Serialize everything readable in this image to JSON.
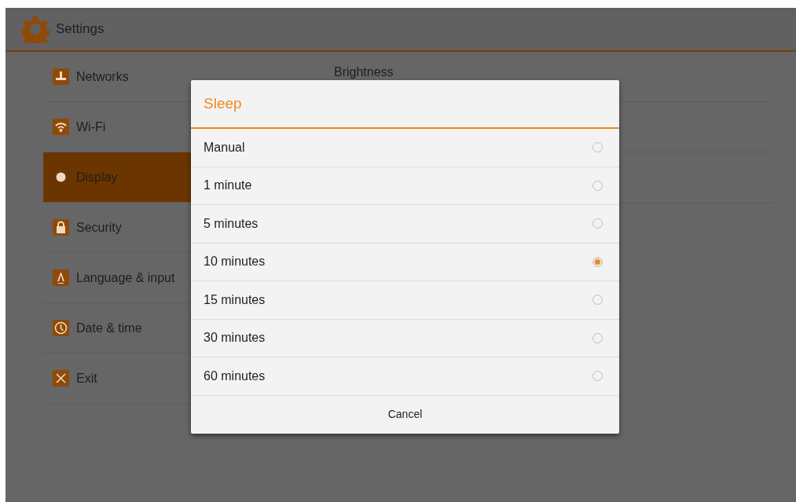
{
  "app_bar": {
    "title": "Settings"
  },
  "sidebar": {
    "items": [
      {
        "kind": "networks",
        "label": "Networks",
        "selected": false
      },
      {
        "kind": "wifi",
        "label": "Wi-Fi",
        "selected": false
      },
      {
        "kind": "display",
        "label": "Display",
        "selected": true
      },
      {
        "kind": "security",
        "label": "Security",
        "selected": false
      },
      {
        "kind": "language",
        "label": "Language & input",
        "selected": false
      },
      {
        "kind": "datetime",
        "label": "Date & time",
        "selected": false
      },
      {
        "kind": "exit",
        "label": "Exit",
        "selected": false
      }
    ]
  },
  "detail": {
    "heading": "Brightness"
  },
  "dialog": {
    "title": "Sleep",
    "options": [
      {
        "label": "Manual",
        "selected": false
      },
      {
        "label": "1 minute",
        "selected": false
      },
      {
        "label": "5 minutes",
        "selected": false
      },
      {
        "label": "10 minutes",
        "selected": true
      },
      {
        "label": "15 minutes",
        "selected": false
      },
      {
        "label": "30 minutes",
        "selected": false
      },
      {
        "label": "60 minutes",
        "selected": false
      }
    ],
    "cancel": "Cancel"
  }
}
